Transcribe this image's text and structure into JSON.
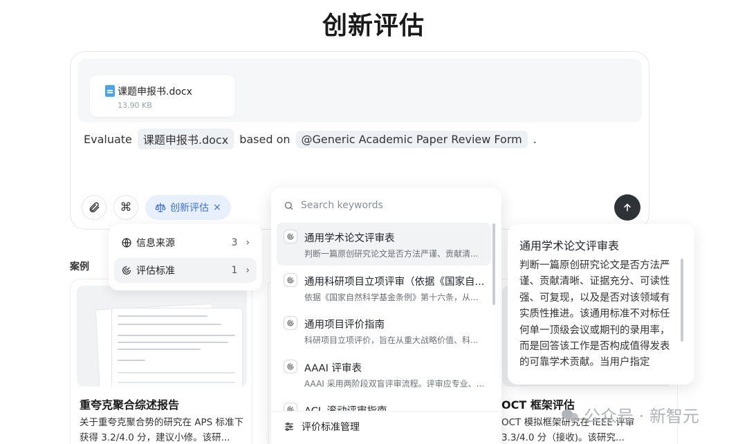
{
  "page": {
    "title": "创新评估"
  },
  "composer": {
    "attachment": {
      "name": "课题申报书.docx",
      "size": "13.90 KB"
    },
    "prompt": {
      "prefix": "Evaluate",
      "file_chip": "课题申报书.docx",
      "middle": "based on",
      "form_chip": "@Generic Academic Paper Review Form",
      "suffix": "."
    },
    "tag": {
      "label": "创新评估",
      "close": "×"
    }
  },
  "mini_menu": {
    "items": [
      {
        "label": "信息来源",
        "count": "3"
      },
      {
        "label": "评估标准",
        "count": "1"
      }
    ]
  },
  "cases": {
    "label": "案例",
    "items": [
      {
        "title": "重夸克聚合综述报告",
        "desc": "关于重夸克聚合势的研究在 APS 标准下获得 3.2/4.0 分，建议小修。该研..."
      },
      {
        "title": "OCT 框架评估",
        "desc": "OCT 模拟框架研究在 IEEE 评审 3.3/4.0 分（接收)。该研究..."
      }
    ]
  },
  "search": {
    "placeholder": "Search keywords",
    "options": [
      {
        "title": "通用学术论文评审表",
        "desc": "判断一篇原创研究论文是否方法严谨、贡献清..."
      },
      {
        "title": "通用科研项目立项评审（依据《国家自...",
        "desc": "依据《国家自然科学基金条例》第十六条，从..."
      },
      {
        "title": "通用项目评价指南",
        "desc": "科研项目立项评价，旨在从重大战略价值、科..."
      },
      {
        "title": "AAAI 评审表",
        "desc": "AAAI 采用两阶段双盲评审流程。评审应专业、..."
      },
      {
        "title": "ACL 滚动评审指南",
        "desc": ""
      }
    ],
    "footer": "评价标准管理"
  },
  "preview": {
    "title": "通用学术论文评审表",
    "body": "判断一篇原创研究论文是否方法严谨、贡献清晰、证据充分、可读性强、可复现，以及是否对该领域有实质性推进。该通用标准不对标任何单一顶级会议或期刊的录用率，而是回答该工作是否构成值得发表的可靠学术贡献。当用户指定"
  },
  "watermark": {
    "text": "公众号 · 新智元"
  },
  "colors": {
    "accent": "#3b6fd4",
    "tag_bg": "#e8f0fd",
    "send": "#2f3338"
  }
}
